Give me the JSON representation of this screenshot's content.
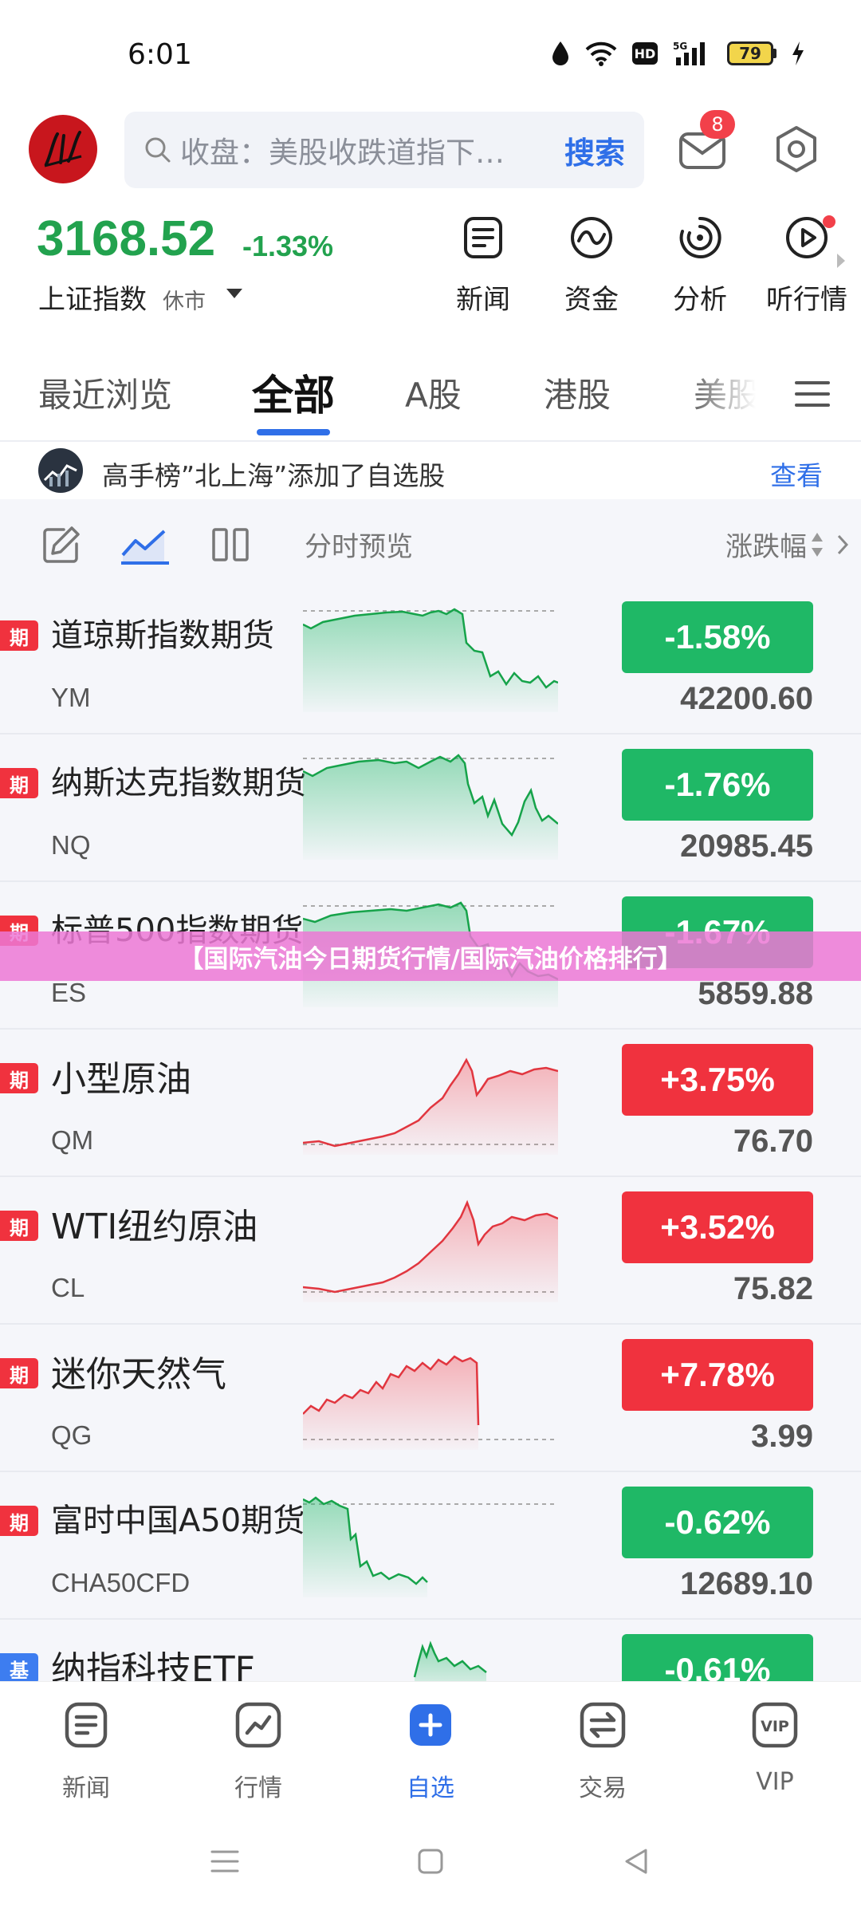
{
  "status_bar": {
    "time": "6:01",
    "battery": "79",
    "network": "5G"
  },
  "header": {
    "search_placeholder": "收盘：美股收跌道指下…",
    "search_button": "搜索",
    "message_badge": "8"
  },
  "index": {
    "value": "3168.52",
    "change": "-1.33%",
    "name": "上证指数",
    "status": "休市"
  },
  "quick_actions": [
    "新闻",
    "资金",
    "分析",
    "听行情"
  ],
  "tabs": [
    "最近浏览",
    "全部",
    "A股",
    "港股",
    "美股"
  ],
  "notice": {
    "text": "高手榜”北上海”添加了自选股",
    "link": "查看"
  },
  "toolbar": {
    "label": "分时预览",
    "sort": "涨跌幅"
  },
  "colors": {
    "up": "#f0323e",
    "down": "#1fb866",
    "accent": "#2f6fe8",
    "futures_tag": "#f0323e",
    "fund_tag": "#3d7df0"
  },
  "rows": [
    {
      "tag": "期",
      "name": "道琼斯指数期货",
      "code": "YM",
      "change": "-1.58%",
      "price": "42200.60",
      "dir": "down"
    },
    {
      "tag": "期",
      "name": "纳斯达克指数期货",
      "code": "NQ",
      "change": "-1.76%",
      "price": "20985.45",
      "dir": "down"
    },
    {
      "tag": "期",
      "name": "标普500指数期货",
      "code": "ES",
      "change": "-1.67%",
      "price": "5859.88",
      "dir": "down"
    },
    {
      "tag": "期",
      "name": "小型原油",
      "code": "QM",
      "change": "+3.75%",
      "price": "76.70",
      "dir": "up"
    },
    {
      "tag": "期",
      "name": "WTI纽约原油",
      "code": "CL",
      "change": "+3.52%",
      "price": "75.82",
      "dir": "up"
    },
    {
      "tag": "期",
      "name": "迷你天然气",
      "code": "QG",
      "change": "+7.78%",
      "price": "3.99",
      "dir": "up"
    },
    {
      "tag": "期",
      "name": "富时中国A50期货",
      "code": "CHA50CFD",
      "change": "-0.62%",
      "price": "12689.10",
      "dir": "down"
    },
    {
      "tag": "基",
      "name": "纳指科技ETF",
      "code": "",
      "change": "-0.61%",
      "price": "",
      "dir": "down"
    }
  ],
  "banner": "【国际汽油今日期货行情/国际汽油价格排行】",
  "bottom_nav": [
    "新闻",
    "行情",
    "自选",
    "交易",
    "VIP"
  ]
}
